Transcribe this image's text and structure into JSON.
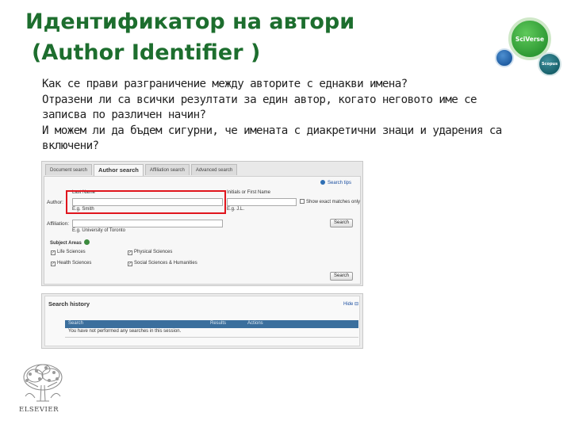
{
  "title": {
    "line1": "Идентификатор на автори",
    "line2": "(Author Identifier )"
  },
  "logos": {
    "sciverse": "SciVerse",
    "scopus": "Scopus",
    "publisher": "ELSEVIER"
  },
  "body_lines": [
    "Как се прави разграничение между авторите с еднакви имена?",
    "Отразени ли са  всички резултати за един автор, когато неговото име се",
    "записва по различен начин?",
    "И можем ли да бъдем сигурни, че имената с диакретични знаци и ударения са",
    "включени?"
  ],
  "search_form": {
    "tabs": [
      {
        "label": "Document search",
        "active": false
      },
      {
        "label": "Author search",
        "active": true
      },
      {
        "label": "Affiliation search",
        "active": false
      },
      {
        "label": "Advanced search",
        "active": false
      }
    ],
    "search_tips": "Search tips",
    "author_label": "Author:",
    "last_name_label": "Last Name",
    "last_name_value": "",
    "last_name_hint": "E.g. Smith",
    "initials_label": "Initials or First Name",
    "initials_value": "",
    "initials_hint": "E.g. J.L.",
    "exact_match_label": "Show exact matches only",
    "affiliation_label": "Affiliation:",
    "affiliation_value": "",
    "affiliation_hint": "E.g. University of Toronto",
    "search_button": "Search",
    "subject_areas_label": "Subject Areas",
    "subjects": [
      {
        "label": "Life Sciences",
        "checked": true
      },
      {
        "label": "Physical Sciences",
        "checked": true
      },
      {
        "label": "Health Sciences",
        "checked": true
      },
      {
        "label": "Social Sciences & Humanities",
        "checked": true
      }
    ],
    "search_button_bottom": "Search"
  },
  "search_history": {
    "title": "Search history",
    "hide_link": "Hide",
    "columns": [
      "Search",
      "Results",
      "Actions"
    ],
    "empty_message": "You have not performed any searches in this session."
  },
  "colors": {
    "title_green": "#1d6e2e",
    "highlight_red": "#e0151d",
    "header_blue": "#3b6f9d"
  }
}
